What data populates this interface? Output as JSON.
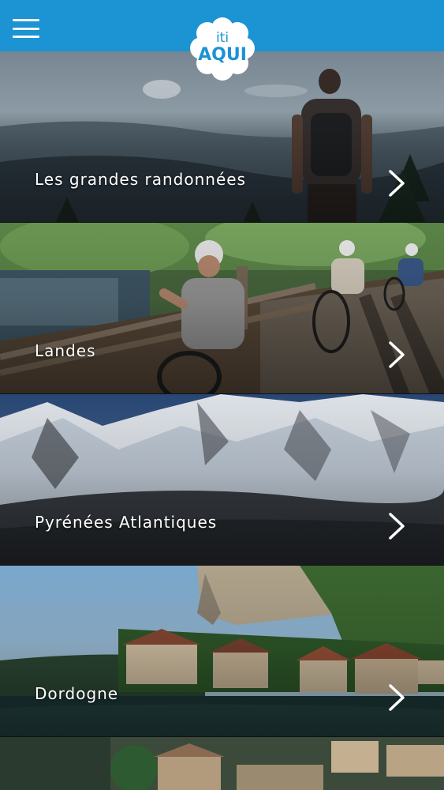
{
  "header": {
    "menu_icon": "hamburger-menu-icon",
    "logo_line1": "iti",
    "logo_line2": "AQUI",
    "bar_color": "#1c93d3"
  },
  "routes": [
    {
      "label": "Les grandes randonnées",
      "chevron_icon": "chevron-right-icon"
    },
    {
      "label": "Landes",
      "chevron_icon": "chevron-right-icon"
    },
    {
      "label": "Pyrénées Atlantiques",
      "chevron_icon": "chevron-right-icon"
    },
    {
      "label": "Dordogne",
      "chevron_icon": "chevron-right-icon"
    }
  ]
}
